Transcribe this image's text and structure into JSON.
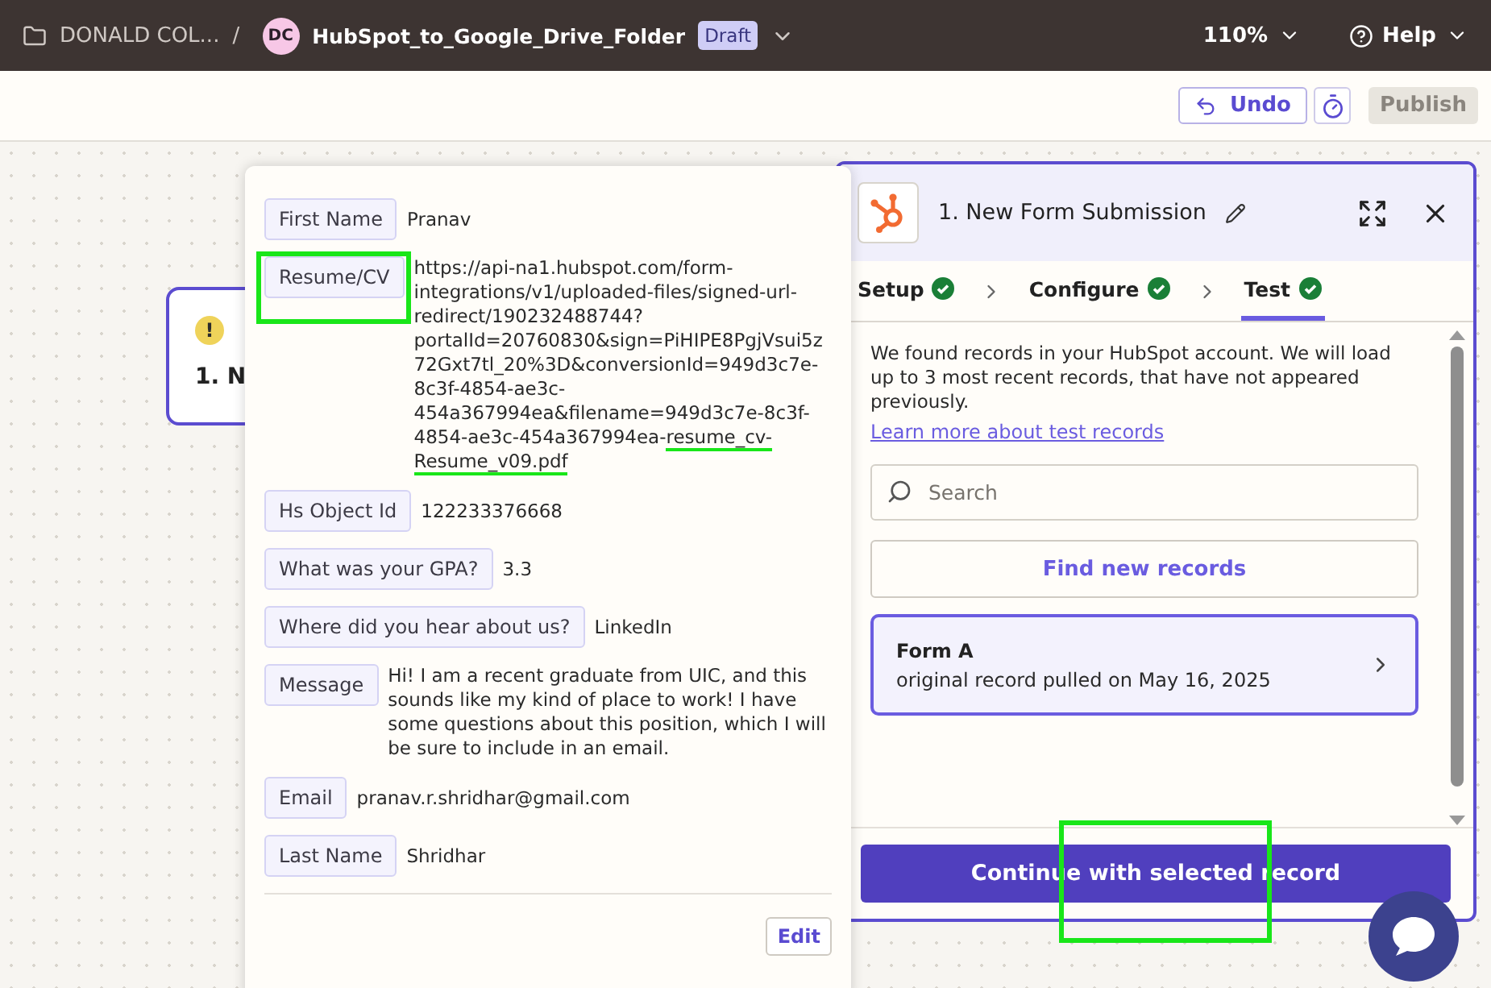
{
  "topbar": {
    "folder": "DONALD COL...",
    "separator": "/",
    "avatar": "DC",
    "title": "HubSpot_to_Google_Drive_Folder",
    "badge": "Draft",
    "zoom": "110%",
    "help": "Help"
  },
  "toolbar": {
    "undo": "Undo",
    "publish": "Publish",
    "publish_disabled": true
  },
  "node": {
    "title": "1. N",
    "warning": true,
    "warning_symbol": "!"
  },
  "popup": {
    "fields": [
      {
        "label": "First Name",
        "value": "Pranav",
        "highlighted": false
      },
      {
        "label": "Resume/CV",
        "value": "https://api-na1.hubspot.com/form-integrations/v1/uploaded-files/signed-url-redirect/190232488744?portalId=20760830&sign=PiHIPE8PgjVsui5z72Gxt7tl_20%3D&conversionId=949d3c7e-8c3f-4854-ae3c-454a367994ea&filename=949d3c7e-8c3f-4854-ae3c-454a367994ea-",
        "value_marked": "resume_cv-Resume_v09.pdf",
        "highlighted": true
      },
      {
        "label": "Hs Object Id",
        "value": "122233376668",
        "highlighted": false
      },
      {
        "label": "What was your GPA?",
        "value": "3.3",
        "highlighted": false
      },
      {
        "label": "Where did you hear about us?",
        "value": "LinkedIn",
        "highlighted": false
      },
      {
        "label": "Message",
        "value": "Hi! I am a recent graduate from UIC, and this sounds like my kind of place to work! I have some questions about this position, which I will be sure to include in an email.",
        "highlighted": false
      },
      {
        "label": "Email",
        "value": "pranav.r.shridhar@gmail.com",
        "highlighted": false
      },
      {
        "label": "Last Name",
        "value": "Shridhar",
        "highlighted": false
      }
    ],
    "edit": "Edit"
  },
  "panel": {
    "title": "1. New Form Submission",
    "steps": [
      {
        "label": "Setup",
        "done": true,
        "selected": false
      },
      {
        "label": "Configure",
        "done": true,
        "selected": false
      },
      {
        "label": "Test",
        "done": true,
        "selected": true
      }
    ],
    "description": "We found records in your HubSpot account. We will load up to 3 most recent records, that have not appeared previously.",
    "link": "Learn more about test records",
    "search": {
      "placeholder": "Search"
    },
    "find": "Find new records",
    "records": [
      {
        "title": "Form A",
        "subtitle": "original record pulled on May 16, 2025",
        "selected": true
      }
    ],
    "continue": {
      "label": "Continue with selected record",
      "highlighted": true
    }
  }
}
